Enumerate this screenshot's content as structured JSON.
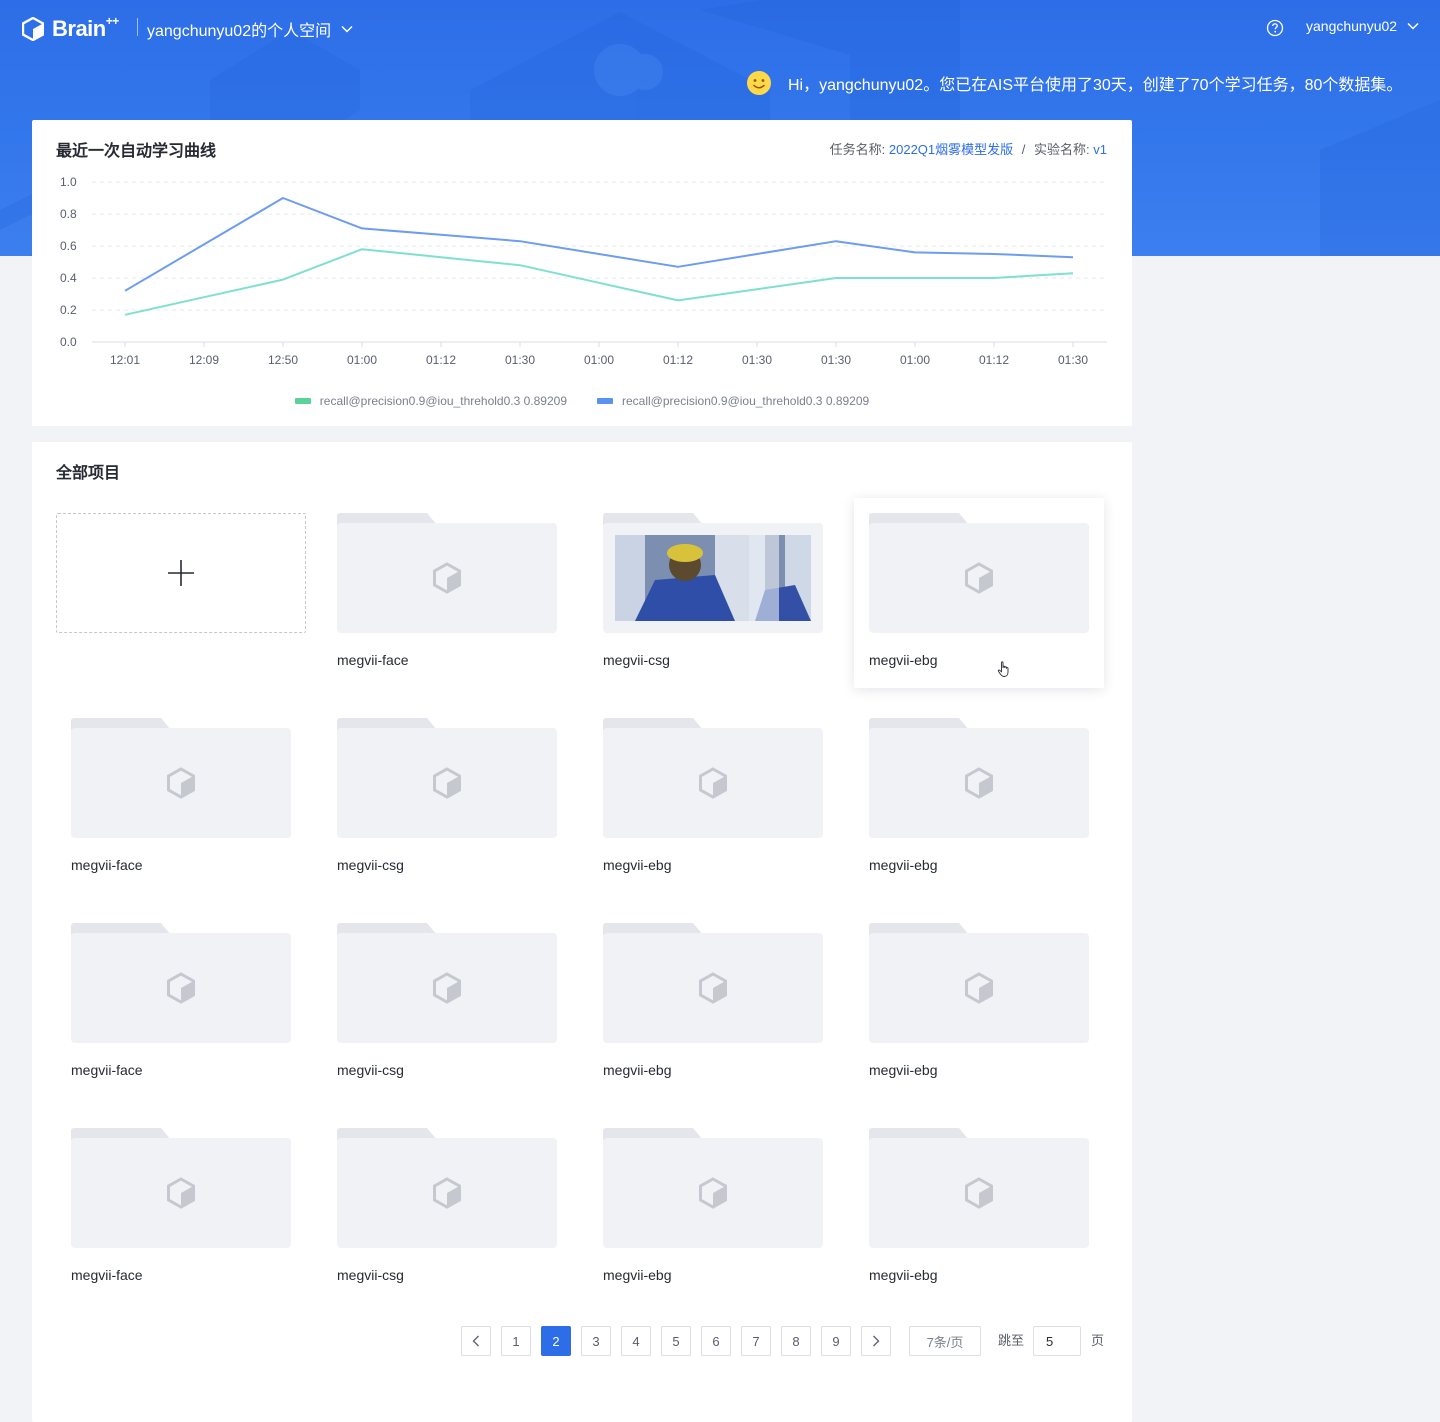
{
  "header": {
    "brand": "Brain",
    "brand_sup": "++",
    "space": "yangchunyu02的个人空间",
    "user": "yangchunyu02"
  },
  "greeting": "Hi，yangchunyu02。您已在AIS平台使用了30天，创建了70个学习任务，80个数据集。",
  "chart_card": {
    "title": "最近一次自动学习曲线",
    "task_label": "任务名称:",
    "task_value": "2022Q1烟雾模型发版",
    "sep": "/",
    "exp_label": "实验名称:",
    "exp_value": "v1"
  },
  "chart_data": {
    "type": "line",
    "x": [
      "12:01",
      "12:09",
      "12:50",
      "01:00",
      "01:12",
      "01:30",
      "01:00",
      "01:12",
      "01:30",
      "01:30",
      "01:00",
      "01:12",
      "01:30"
    ],
    "ylim": [
      0,
      1.0
    ],
    "yticks": [
      "0.0",
      "0.2",
      "0.4",
      "0.6",
      "0.8",
      "1.0"
    ],
    "grid": true,
    "legend": "bottom",
    "series": [
      {
        "name": "recall@precision0.9@iou_threhold0.3 0.89209",
        "color": "#7ee0cf",
        "values": [
          0.17,
          0.28,
          0.39,
          0.58,
          0.53,
          0.48,
          0.37,
          0.26,
          0.33,
          0.4,
          0.4,
          0.4,
          0.43
        ]
      },
      {
        "name": "recall@precision0.9@iou_threhold0.3 0.89209",
        "color": "#6d9cf0",
        "values": [
          0.32,
          0.61,
          0.9,
          0.71,
          0.67,
          0.63,
          0.55,
          0.47,
          0.55,
          0.63,
          0.56,
          0.55,
          0.53
        ]
      }
    ]
  },
  "projects": {
    "title": "全部项目",
    "items": [
      {
        "name": "megvii-face",
        "thumb": false
      },
      {
        "name": "megvii-csg",
        "thumb": true
      },
      {
        "name": "megvii-ebg",
        "thumb": false,
        "hover": true
      },
      {
        "name": "megvii-face",
        "thumb": false
      },
      {
        "name": "megvii-csg",
        "thumb": false
      },
      {
        "name": "megvii-ebg",
        "thumb": false
      },
      {
        "name": "megvii-ebg",
        "thumb": false
      },
      {
        "name": "megvii-face",
        "thumb": false
      },
      {
        "name": "megvii-csg",
        "thumb": false
      },
      {
        "name": "megvii-ebg",
        "thumb": false
      },
      {
        "name": "megvii-ebg",
        "thumb": false
      },
      {
        "name": "megvii-face",
        "thumb": false
      },
      {
        "name": "megvii-csg",
        "thumb": false
      },
      {
        "name": "megvii-ebg",
        "thumb": false
      },
      {
        "name": "megvii-ebg",
        "thumb": false
      }
    ]
  },
  "pagination": {
    "pages": [
      "1",
      "2",
      "3",
      "4",
      "5",
      "6",
      "7",
      "8",
      "9"
    ],
    "current": "2",
    "page_size": "7条/页",
    "jump_label": "跳至",
    "jump_value": "5",
    "unit": "页"
  },
  "colors": {
    "accent": "#2d6ee8",
    "series1": "#7ee0cf",
    "series2": "#6d9cf0"
  }
}
